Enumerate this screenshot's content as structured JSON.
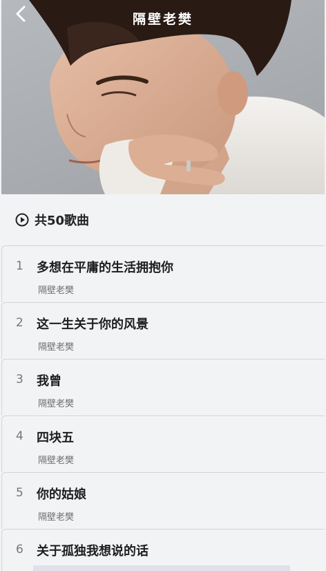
{
  "header": {
    "title": "隔壁老樊",
    "back_icon": "chevron-left-icon"
  },
  "playlist": {
    "count_label": "共50歌曲",
    "play_icon": "play-circle-icon"
  },
  "songs": [
    {
      "index": "1",
      "title": "多想在平庸的生活拥抱你",
      "artist": "隔壁老樊"
    },
    {
      "index": "2",
      "title": "这一生关于你的风景",
      "artist": "隔壁老樊"
    },
    {
      "index": "3",
      "title": "我曾",
      "artist": "隔壁老樊"
    },
    {
      "index": "4",
      "title": "四块五",
      "artist": "隔壁老樊"
    },
    {
      "index": "5",
      "title": "你的姑娘",
      "artist": "隔壁老樊"
    },
    {
      "index": "6",
      "title": "关于孤独我想说的话",
      "artist": ""
    }
  ],
  "colors": {
    "background": "#f2f3f5",
    "title_text": "#ffffff",
    "song_title": "#1e1e1e",
    "song_artist": "#6e6e6e",
    "divider": "#d3d4d8"
  }
}
